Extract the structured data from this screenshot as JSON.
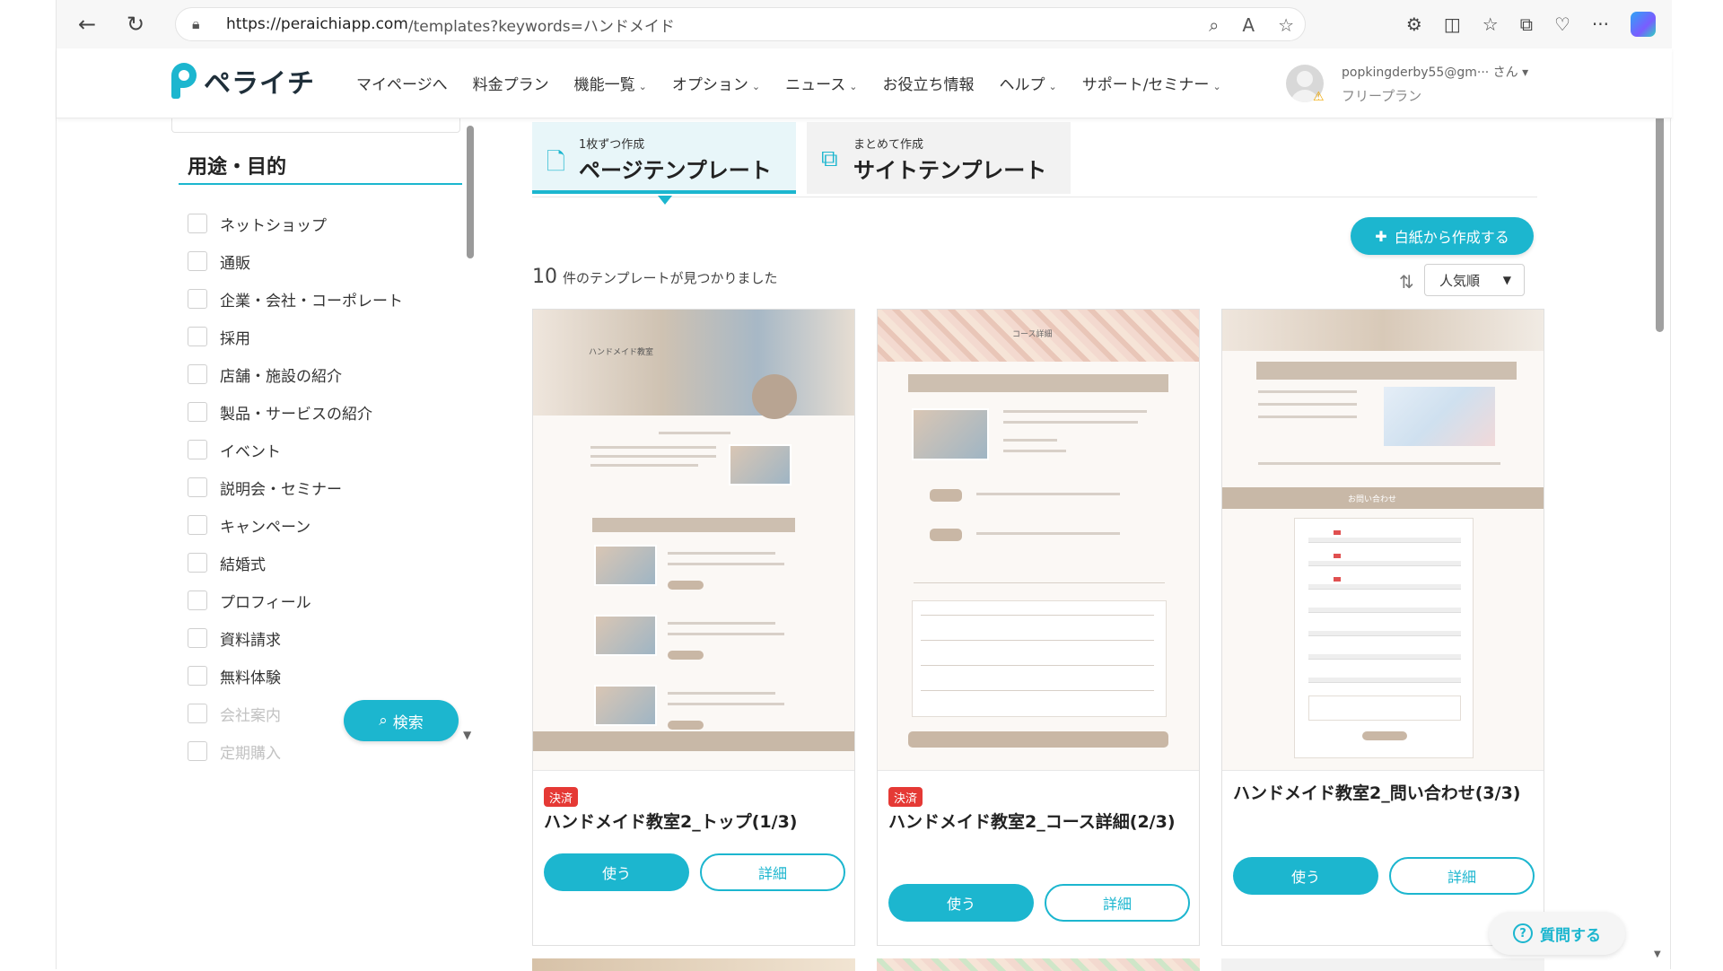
{
  "browser": {
    "url_host": "https://peraichiapp.com",
    "url_path": "/templates?keywords=ハンドメイド"
  },
  "header": {
    "logo_text": "ペライチ",
    "nav": [
      {
        "label": "マイページへ",
        "dropdown": false
      },
      {
        "label": "料金プラン",
        "dropdown": false
      },
      {
        "label": "機能一覧",
        "dropdown": true
      },
      {
        "label": "オプション",
        "dropdown": true
      },
      {
        "label": "ニュース",
        "dropdown": true
      },
      {
        "label": "お役立ち情報",
        "dropdown": false
      },
      {
        "label": "ヘルプ",
        "dropdown": true
      },
      {
        "label": "サポート/セミナー",
        "dropdown": true
      }
    ],
    "user_email": "popkingderby55@gm··· さん",
    "user_plan": "フリープラン"
  },
  "sidebar": {
    "heading": "用途・目的",
    "items": [
      {
        "label": "ネットショップ"
      },
      {
        "label": "通販"
      },
      {
        "label": "企業・会社・コーポレート"
      },
      {
        "label": "採用"
      },
      {
        "label": "店舗・施設の紹介"
      },
      {
        "label": "製品・サービスの紹介"
      },
      {
        "label": "イベント"
      },
      {
        "label": "説明会・セミナー"
      },
      {
        "label": "キャンペーン"
      },
      {
        "label": "結婚式"
      },
      {
        "label": "プロフィール"
      },
      {
        "label": "資料請求"
      },
      {
        "label": "無料体験"
      },
      {
        "label": "会社案内"
      },
      {
        "label": "定期購入"
      }
    ],
    "search_label": "検索"
  },
  "main": {
    "tabs": [
      {
        "small": "1枚ずつ作成",
        "big": "ページテンプレート"
      },
      {
        "small": "まとめて作成",
        "big": "サイトテンプレート"
      }
    ],
    "create_label": "白紙から作成する",
    "found_count": "10",
    "found_text": "件のテンプレートが見つかりました",
    "sort_label": "人気順",
    "cards": [
      {
        "badge": "決済",
        "title": "ハンドメイド教室2_トップ(1/3)",
        "use": "使う",
        "detail": "詳細",
        "thumb_hero_text": "ハンドメイド教室"
      },
      {
        "badge": "決済",
        "title": "ハンドメイド教室2_コース詳細(2/3)",
        "use": "使う",
        "detail": "詳細",
        "thumb_hero_text": "コース詳細"
      },
      {
        "badge": "",
        "title": "ハンドメイド教室2_問い合わせ(3/3)",
        "use": "使う",
        "detail": "詳細",
        "thumb_hero_text": "お問い合わせ"
      }
    ]
  },
  "help": {
    "question_label": "質問する"
  },
  "colors": {
    "accent": "#1cb6cf",
    "badge": "#e53935"
  }
}
